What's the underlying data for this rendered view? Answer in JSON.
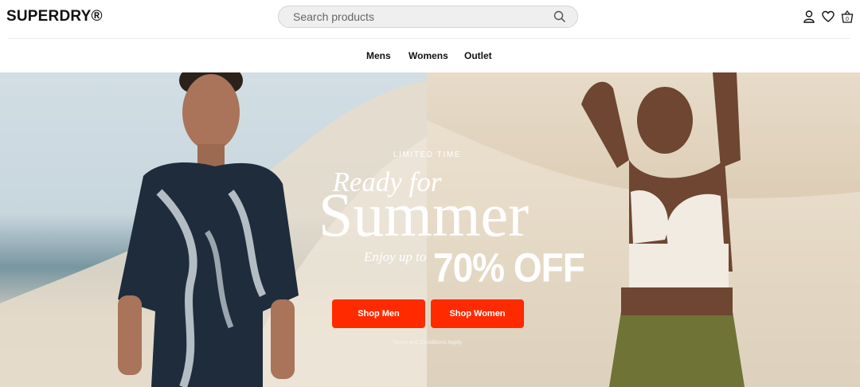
{
  "header": {
    "logo": "SUPERDRY®",
    "search_placeholder": "Search products",
    "icons": [
      "account-icon",
      "heart-icon",
      "basket-icon"
    ],
    "basket_count": "0"
  },
  "nav": {
    "items": [
      "Mens",
      "Womens",
      "Outlet"
    ]
  },
  "hero": {
    "eyebrow": "LIMITED TIME",
    "headline_line1": "Ready for",
    "headline_line2": "Summer",
    "enjoy": "Enjoy up to",
    "discount": "70% OFF",
    "buttons": [
      "Shop Men",
      "Shop Women"
    ],
    "terms": "Terms and Conditions Apply.",
    "colors": {
      "cta": "#ff2a00"
    }
  }
}
